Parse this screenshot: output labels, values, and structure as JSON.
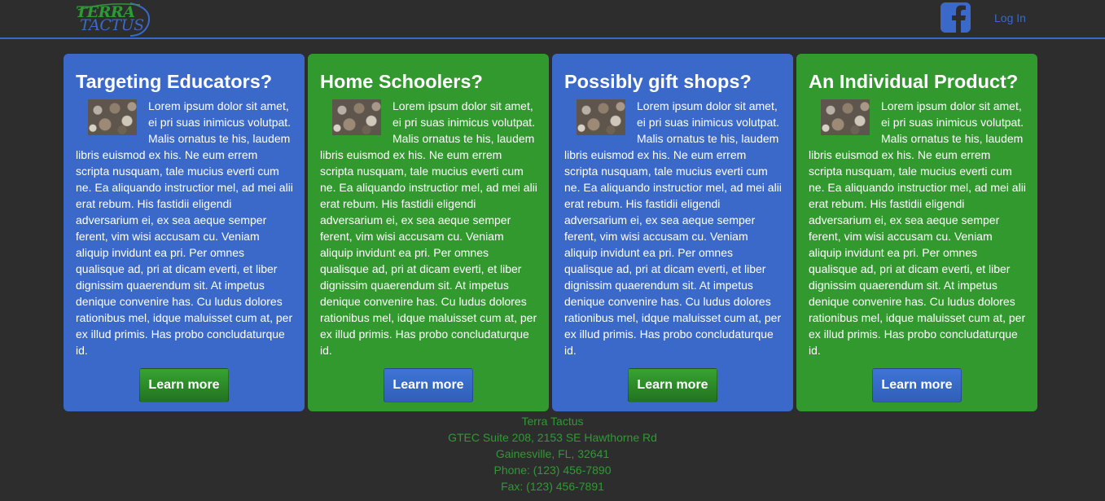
{
  "header": {
    "logo_line1": "TERRA",
    "logo_line2": "TACTUS",
    "login_label": "Log In",
    "icons": [
      "facebook-icon"
    ]
  },
  "colors": {
    "blue": "#3a69c9",
    "green": "#32992f",
    "background": "#2d2d2d"
  },
  "cards": [
    {
      "title": "Targeting Educators?",
      "body": "Lorem ipsum dolor sit amet, ei pri suas inimicus volutpat. Malis ornatus te his, laudem libris euismod ex his. Ne eum errem scripta nusquam, tale mucius everti cum ne. Ea aliquando instructior mel, ad mei alii erat rebum. His fastidii eligendi adversarium ei, ex sea aeque semper ferent, vim wisi accusam cu. Veniam aliquip invidunt ea pri. Per omnes qualisque ad, pri at dicam everti, et liber dignissim quaerendum sit. At impetus denique convenire has. Cu ludus dolores rationibus mel, idque maluisset cum at, per ex illud primis. Has probo concludaturque id.",
      "button": "Learn more"
    },
    {
      "title": "Home Schoolers?",
      "body": "Lorem ipsum dolor sit amet, ei pri suas inimicus volutpat. Malis ornatus te his, laudem libris euismod ex his. Ne eum errem scripta nusquam, tale mucius everti cum ne. Ea aliquando instructior mel, ad mei alii erat rebum. His fastidii eligendi adversarium ei, ex sea aeque semper ferent, vim wisi accusam cu. Veniam aliquip invidunt ea pri. Per omnes qualisque ad, pri at dicam everti, et liber dignissim quaerendum sit. At impetus denique convenire has. Cu ludus dolores rationibus mel, idque maluisset cum at, per ex illud primis. Has probo concludaturque id.",
      "button": "Learn more"
    },
    {
      "title": "Possibly gift shops?",
      "body": "Lorem ipsum dolor sit amet, ei pri suas inimicus volutpat. Malis ornatus te his, laudem libris euismod ex his. Ne eum errem scripta nusquam, tale mucius everti cum ne. Ea aliquando instructior mel, ad mei alii erat rebum. His fastidii eligendi adversarium ei, ex sea aeque semper ferent, vim wisi accusam cu. Veniam aliquip invidunt ea pri. Per omnes qualisque ad, pri at dicam everti, et liber dignissim quaerendum sit. At impetus denique convenire has. Cu ludus dolores rationibus mel, idque maluisset cum at, per ex illud primis. Has probo concludaturque id.",
      "button": "Learn more"
    },
    {
      "title": "An Individual Product?",
      "body": "Lorem ipsum dolor sit amet, ei pri suas inimicus volutpat. Malis ornatus te his, laudem libris euismod ex his. Ne eum errem scripta nusquam, tale mucius everti cum ne. Ea aliquando instructior mel, ad mei alii erat rebum. His fastidii eligendi adversarium ei, ex sea aeque semper ferent, vim wisi accusam cu. Veniam aliquip invidunt ea pri. Per omnes qualisque ad, pri at dicam everti, et liber dignissim quaerendum sit. At impetus denique convenire has. Cu ludus dolores rationibus mel, idque maluisset cum at, per ex illud primis. Has probo concludaturque id.",
      "button": "Learn more"
    }
  ],
  "footer": {
    "company": "Terra Tactus",
    "address1": "GTEC Suite 208, 2153 SE Hawthorne Rd",
    "address2": "Gainesville, FL, 32641",
    "phone": "Phone: (123) 456-7890",
    "fax": "Fax: (123) 456-7891"
  }
}
